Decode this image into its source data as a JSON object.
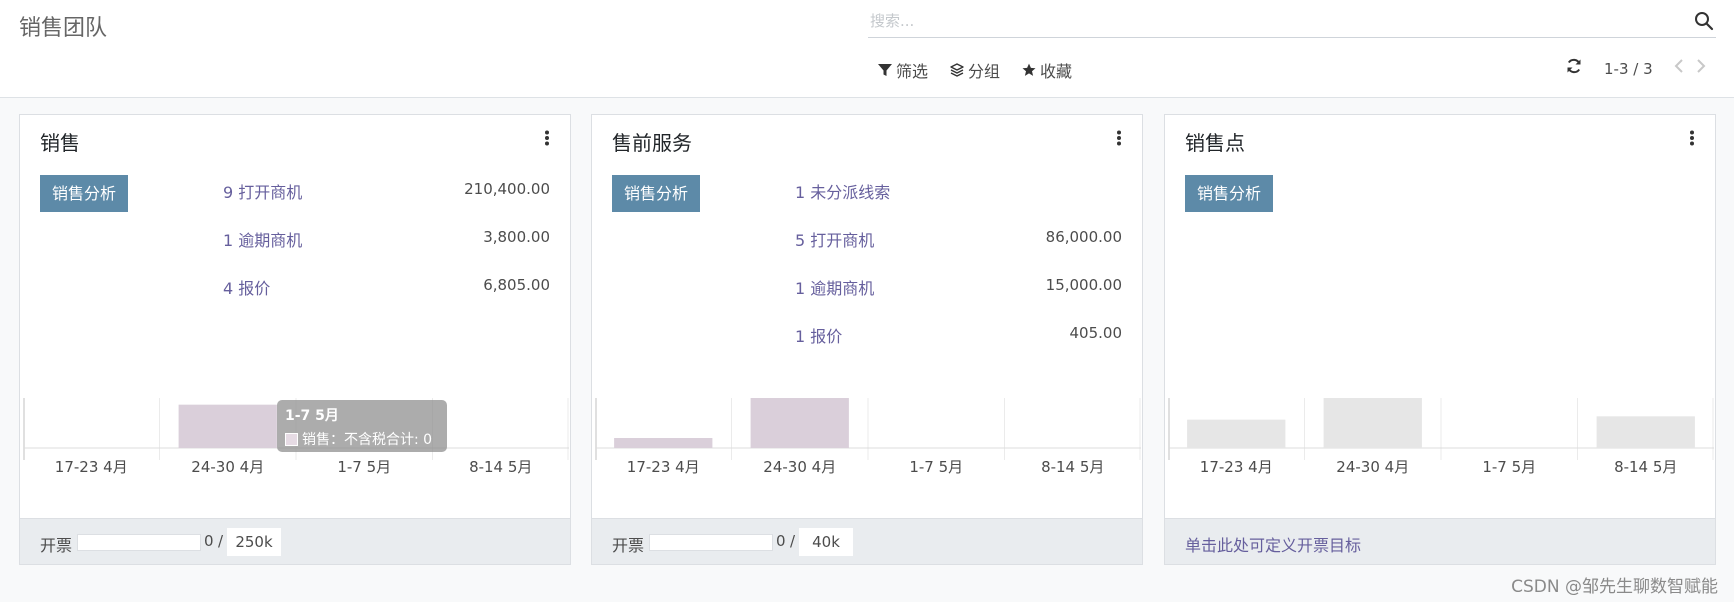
{
  "header": {
    "title": "销售团队",
    "search_placeholder": "搜索..."
  },
  "toolbar": {
    "filters": "筛选",
    "group_by": "分组",
    "favorites": "收藏"
  },
  "pager": {
    "value": "1-3 / 3"
  },
  "colors": {
    "accent": "#5d8aa8",
    "link": "#665f9d",
    "bar_active": "#dacfda",
    "bar_empty": "#e6e6e6"
  },
  "teams": [
    {
      "name": "销售",
      "analysis_button": "销售分析",
      "stats": [
        {
          "label": "9 打开商机",
          "value": "210,400.00"
        },
        {
          "label": "1 逾期商机",
          "value": "3,800.00"
        },
        {
          "label": "4 报价",
          "value": "6,805.00"
        }
      ],
      "footer_label": "开票",
      "invoiced": "0",
      "slash": "/",
      "target": "250k",
      "progress_fraction": 0,
      "tooltip": {
        "title": "1-7 5月",
        "series_label": "销售：不含税合计: 0"
      }
    },
    {
      "name": "售前服务",
      "analysis_button": "销售分析",
      "stats": [
        {
          "label": "1 未分派线索",
          "value": ""
        },
        {
          "label": "5 打开商机",
          "value": "86,000.00"
        },
        {
          "label": "1 逾期商机",
          "value": "15,000.00"
        },
        {
          "label": "1 报价",
          "value": "405.00"
        }
      ],
      "footer_label": "开票",
      "invoiced": "0",
      "slash": "/",
      "target": "40k",
      "progress_fraction": 0
    },
    {
      "name": "销售点",
      "analysis_button": "销售分析",
      "stats": [],
      "target_link": "单击此处可定义开票目标"
    }
  ],
  "chart_data": [
    {
      "type": "bar",
      "categories": [
        "17-23 4月",
        "24-30 4月",
        "1-7 5月",
        "8-14 5月"
      ],
      "values": [
        0,
        52,
        0,
        0
      ],
      "ylim": [
        0,
        60
      ],
      "color": "#dacfda"
    },
    {
      "type": "bar",
      "categories": [
        "17-23 4月",
        "24-30 4月",
        "1-7 5月",
        "8-14 5月"
      ],
      "values": [
        12,
        60,
        0,
        0
      ],
      "ylim": [
        0,
        60
      ],
      "color": "#dacfda"
    },
    {
      "type": "bar",
      "categories": [
        "17-23 4月",
        "24-30 4月",
        "1-7 5月",
        "8-14 5月"
      ],
      "values": [
        34,
        60,
        0,
        38
      ],
      "ylim": [
        0,
        60
      ],
      "color": "#e6e6e6"
    }
  ],
  "watermark": "CSDN @邹先生聊数智赋能"
}
